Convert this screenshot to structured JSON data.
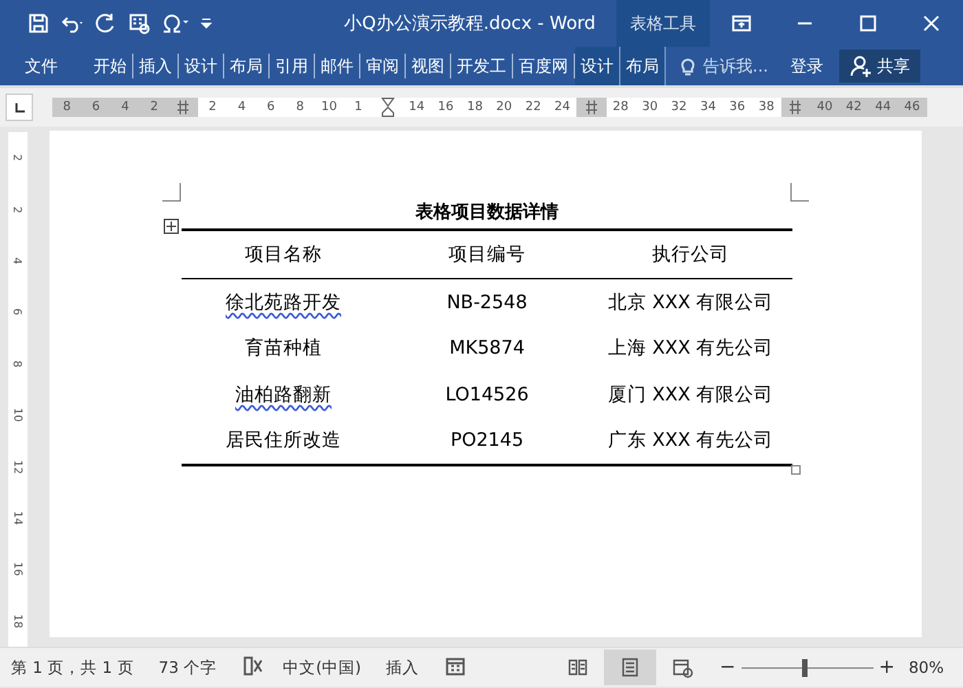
{
  "window": {
    "title": "小Q办公演示教程.docx - Word",
    "context_label": "表格工具"
  },
  "ribbon": {
    "file_tab": "文件",
    "tabs": [
      {
        "label": "开始",
        "contextual": false
      },
      {
        "label": "插入",
        "contextual": false
      },
      {
        "label": "设计",
        "contextual": false
      },
      {
        "label": "布局",
        "contextual": false
      },
      {
        "label": "引用",
        "contextual": false
      },
      {
        "label": "邮件",
        "contextual": false
      },
      {
        "label": "审阅",
        "contextual": false
      },
      {
        "label": "视图",
        "contextual": false
      },
      {
        "label": "开发工",
        "contextual": false
      },
      {
        "label": "百度网",
        "contextual": false
      },
      {
        "label": "设计",
        "contextual": true
      },
      {
        "label": "布局",
        "contextual": true
      }
    ],
    "tell_me": "告诉我...",
    "sign_in": "登录",
    "share": "共享"
  },
  "ruler": [
    {
      "label": "8",
      "kind": "margin"
    },
    {
      "label": "6",
      "kind": "margin"
    },
    {
      "label": "4",
      "kind": "margin"
    },
    {
      "label": "2",
      "kind": "margin"
    },
    {
      "kind": "marker"
    },
    {
      "label": "2",
      "kind": "text"
    },
    {
      "label": "4",
      "kind": "text"
    },
    {
      "label": "6",
      "kind": "text"
    },
    {
      "label": "8",
      "kind": "text"
    },
    {
      "label": "10",
      "kind": "text"
    },
    {
      "label": "1",
      "kind": "text"
    },
    {
      "kind": "indent"
    },
    {
      "label": "14",
      "kind": "text"
    },
    {
      "label": "16",
      "kind": "text"
    },
    {
      "label": "18",
      "kind": "text"
    },
    {
      "label": "20",
      "kind": "text"
    },
    {
      "label": "22",
      "kind": "text"
    },
    {
      "label": "24",
      "kind": "text"
    },
    {
      "kind": "marker"
    },
    {
      "label": "28",
      "kind": "text"
    },
    {
      "label": "30",
      "kind": "text"
    },
    {
      "label": "32",
      "kind": "text"
    },
    {
      "label": "34",
      "kind": "text"
    },
    {
      "label": "36",
      "kind": "text"
    },
    {
      "label": "38",
      "kind": "text"
    },
    {
      "kind": "marker"
    },
    {
      "label": "40",
      "kind": "margin"
    },
    {
      "label": "42",
      "kind": "margin"
    },
    {
      "label": "44",
      "kind": "margin"
    },
    {
      "label": "46",
      "kind": "margin"
    }
  ],
  "vertical_ruler": [
    "2",
    "2",
    "4",
    "6",
    "8",
    "10",
    "12",
    "14",
    "16",
    "18"
  ],
  "table": {
    "title": "表格项目数据详情",
    "columns": [
      "项目名称",
      "项目编号",
      "执行公司"
    ],
    "rows": [
      [
        {
          "text": "徐北苑路开发",
          "misspelled": true
        },
        {
          "text": "NB-2548",
          "misspelled": false
        },
        {
          "text": "北京 XXX 有限公司",
          "misspelled": false
        }
      ],
      [
        {
          "text": "育苗种植",
          "misspelled": false
        },
        {
          "text": "MK5874",
          "misspelled": false
        },
        {
          "text": "上海 XXX 有先公司",
          "misspelled": false
        }
      ],
      [
        {
          "text": "油柏路翻新",
          "misspelled": true
        },
        {
          "text": "LO14526",
          "misspelled": false
        },
        {
          "text": "厦门 XXX 有限公司",
          "misspelled": false
        }
      ],
      [
        {
          "text": "居民住所改造",
          "misspelled": false
        },
        {
          "text": "PO2145",
          "misspelled": false
        },
        {
          "text": "广东 XXX 有先公司",
          "misspelled": false
        }
      ]
    ]
  },
  "status_bar": {
    "page": "第 1 页，共 1 页",
    "words": "73 个字",
    "language": "中文(中国)",
    "mode": "插入",
    "views": [
      {
        "kind": "read",
        "selected": false
      },
      {
        "kind": "print",
        "selected": true
      },
      {
        "kind": "web",
        "selected": false
      }
    ],
    "zoom": {
      "out": "−",
      "in": "+",
      "level": 0.48,
      "reading": "80%"
    }
  }
}
